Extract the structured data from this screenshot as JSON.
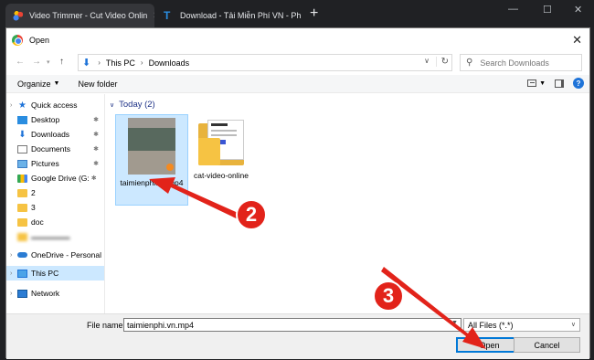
{
  "browser": {
    "tabs": [
      {
        "title": "Video Trimmer - Cut Video Onlin",
        "active": true
      },
      {
        "title": "Download - Tải Miễn Phí VN - Ph",
        "active": false
      }
    ],
    "controls": {
      "minimize": "—",
      "maximize": "☐",
      "close": "✕"
    }
  },
  "dialog": {
    "title": "Open",
    "address": {
      "root": "This PC",
      "folder": "Downloads"
    },
    "search_placeholder": "Search Downloads",
    "toolbar": {
      "organize": "Organize",
      "new_folder": "New folder"
    },
    "sidebar": [
      {
        "label": "Quick access",
        "icon": "star-icon",
        "pinned": false
      },
      {
        "label": "Desktop",
        "icon": "desktop-icon",
        "pinned": true
      },
      {
        "label": "Downloads",
        "icon": "download-icon",
        "pinned": true
      },
      {
        "label": "Documents",
        "icon": "documents-icon",
        "pinned": true
      },
      {
        "label": "Pictures",
        "icon": "pictures-icon",
        "pinned": true
      },
      {
        "label": "Google Drive (G:",
        "icon": "google-drive-icon",
        "pinned": true
      },
      {
        "label": "2",
        "icon": "folder-icon",
        "pinned": false
      },
      {
        "label": "3",
        "icon": "folder-icon",
        "pinned": false
      },
      {
        "label": "doc",
        "icon": "folder-icon",
        "pinned": false
      },
      {
        "label": "OneDrive - Personal",
        "icon": "onedrive-icon",
        "pinned": false
      },
      {
        "label": "This PC",
        "icon": "this-pc-icon",
        "pinned": false
      },
      {
        "label": "Network",
        "icon": "network-icon",
        "pinned": false
      }
    ],
    "group_header": "Today (2)",
    "files": [
      {
        "name": "taimienphi.vn.mp4",
        "type": "video",
        "selected": true
      },
      {
        "name": "cat-video-online",
        "type": "folder",
        "selected": false
      }
    ],
    "file_name_label": "File name:",
    "file_name_value": "taimienphi.vn.mp4",
    "file_type": "All Files (*.*)",
    "open_label": "Open",
    "cancel_label": "Cancel"
  },
  "annotations": {
    "step_2": "2",
    "step_3": "3",
    "arrow_color": "#e2231a"
  }
}
